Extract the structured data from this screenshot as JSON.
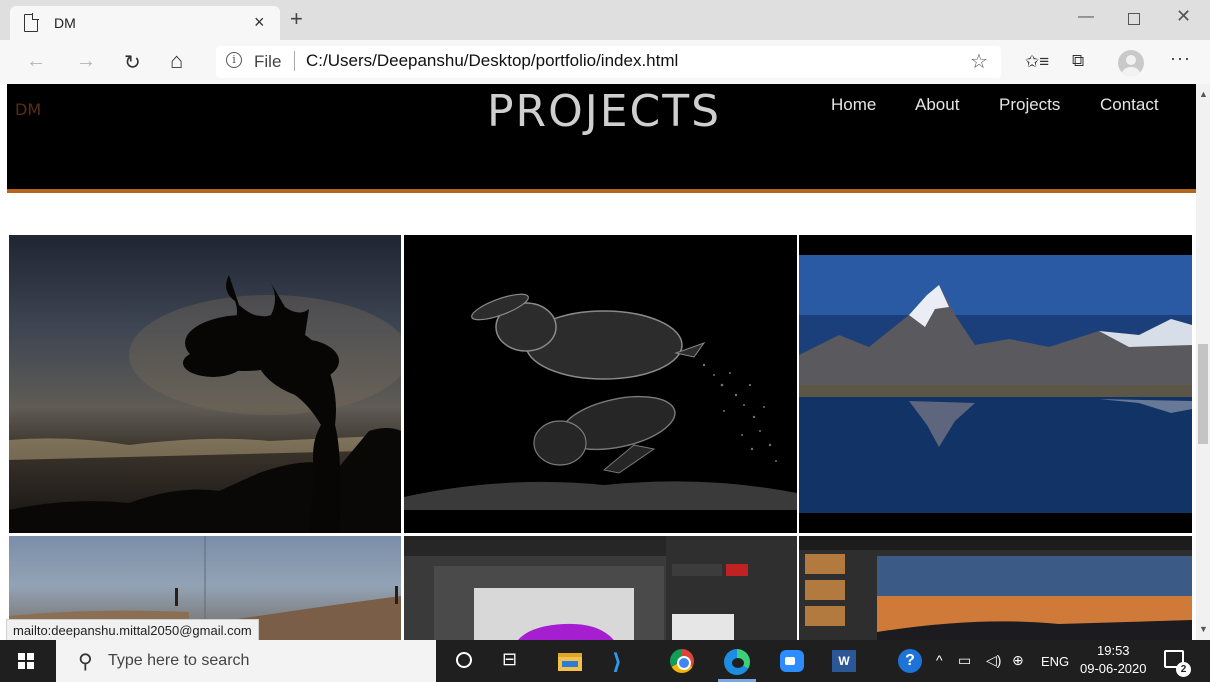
{
  "browser": {
    "tab_title": "DM",
    "tab_close": "×",
    "new_tab": "+",
    "window_controls": {
      "minimize": "—",
      "close": "✕"
    },
    "address": {
      "info_glyph": "i",
      "scheme_label": "File",
      "url": "C:/Users/Deepanshu/Desktop/portfolio/index.html"
    },
    "icons": {
      "back": "←",
      "forward": "→",
      "refresh": "↻",
      "home": "⌂",
      "star": "☆",
      "favorites": "✩≡",
      "collections": "⧉",
      "more": "···"
    }
  },
  "site": {
    "logo": "DM",
    "heading": "PROJECTS",
    "nav": [
      "Home",
      "About",
      "Projects",
      "Contact"
    ],
    "accent_color": "#b5651d",
    "gallery": [
      "tree-silhouette",
      "leaping-hares",
      "mountain-lake-reflection",
      "beach-panorama",
      "photo-editor-car",
      "photo-editor-sunset"
    ]
  },
  "status_bar": {
    "hover_link": "mailto:deepanshu.mittal2050@gmail.com"
  },
  "taskbar": {
    "search_placeholder": "Type here to search",
    "search_glyph": "⚲",
    "taskview_glyph": "⊟",
    "vscode_glyph": "⟩",
    "word_label": "W",
    "help_glyph": "?",
    "tray": {
      "chevron": "^",
      "battery": "▭",
      "volume": "◁)",
      "network": "⊕"
    },
    "language": "ENG",
    "time": "19:53",
    "date": "09-06-2020",
    "notifications": "2"
  }
}
